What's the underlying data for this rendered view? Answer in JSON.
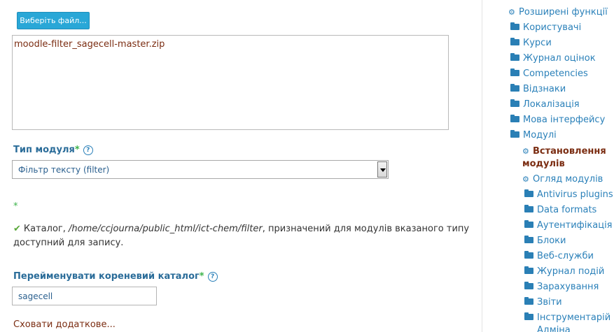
{
  "upload": {
    "choose_button": "Виберіть файл...",
    "filename": "moodle-filter_sagecell-master.zip"
  },
  "plugin_type": {
    "label": "Тип модуля",
    "required_mark": "*",
    "help_icon": "?",
    "selected": "Фільтр тексту (filter)"
  },
  "lone_required_mark": "*",
  "notice": {
    "check_icon": "✔",
    "prefix": "Каталог, ",
    "path": "/home/ccjourna/public_html/ict-chem/filter",
    "suffix": ", призначений для модулів вказаного типу доступний для запису."
  },
  "rename_root": {
    "label": "Перейменувати кореневий каталог",
    "required_mark": "*",
    "help_icon": "?",
    "value": "sagecell"
  },
  "collapse_link": "Сховати додаткове...",
  "sidebar": {
    "items": [
      {
        "label": "Розширені функції",
        "icon": "cog-icon"
      },
      {
        "label": "Користувачі",
        "icon": "folder-icon"
      },
      {
        "label": "Курси",
        "icon": "folder-icon"
      },
      {
        "label": "Журнал оцінок",
        "icon": "folder-icon"
      },
      {
        "label": "Competencies",
        "icon": "folder-icon"
      },
      {
        "label": "Відзнаки",
        "icon": "folder-icon"
      },
      {
        "label": "Локалізація",
        "icon": "folder-icon"
      },
      {
        "label": "Мова інтерфейсу",
        "icon": "folder-icon"
      },
      {
        "label": "Модулі",
        "icon": "folder-icon"
      }
    ],
    "subitems": [
      {
        "label_line1": "Встановлення",
        "label_line2": "модулів",
        "icon": "cog-icon"
      },
      {
        "label": "Огляд модулів",
        "icon": "cog-icon"
      },
      {
        "label": "Antivirus plugins",
        "icon": "folder-icon"
      },
      {
        "label": "Data formats",
        "icon": "folder-icon"
      },
      {
        "label": "Аутентифікація",
        "icon": "folder-icon"
      },
      {
        "label": "Блоки",
        "icon": "folder-icon"
      },
      {
        "label": "Веб-служби",
        "icon": "folder-icon"
      },
      {
        "label": "Журнал подій",
        "icon": "folder-icon"
      },
      {
        "label": "Зарахування",
        "icon": "folder-icon"
      },
      {
        "label": "Звіти",
        "icon": "folder-icon"
      },
      {
        "label": "Інструментарій",
        "icon": "folder-icon"
      },
      {
        "label": "Адміна",
        "icon": "folder-icon"
      }
    ],
    "cog_glyph": "⚙"
  }
}
